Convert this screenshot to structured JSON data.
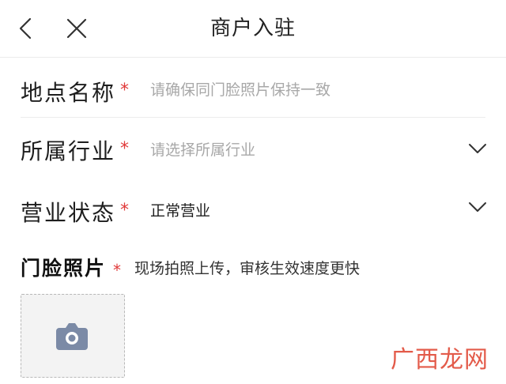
{
  "header": {
    "title": "商户入驻"
  },
  "form": {
    "location_name": {
      "label": "地点名称",
      "required_mark": "*",
      "placeholder": "请确保同门脸照片保持一致"
    },
    "industry": {
      "label": "所属行业",
      "required_mark": "*",
      "placeholder": "请选择所属行业"
    },
    "business_status": {
      "label": "营业状态",
      "required_mark": "*",
      "value": "正常营业"
    }
  },
  "photo": {
    "title": "门脸照片",
    "required_mark": "*",
    "hint": "现场拍照上传，审核生效速度更快"
  },
  "watermark": "广西龙网",
  "icons": {
    "back": "chevron-left-icon",
    "close": "close-icon",
    "dropdown": "chevron-down-icon",
    "camera": "camera-icon"
  },
  "colors": {
    "required": "#e03a3a",
    "placeholder": "#a8a8a8",
    "camera": "#7b8aa6",
    "watermark": "#e35b4a"
  }
}
